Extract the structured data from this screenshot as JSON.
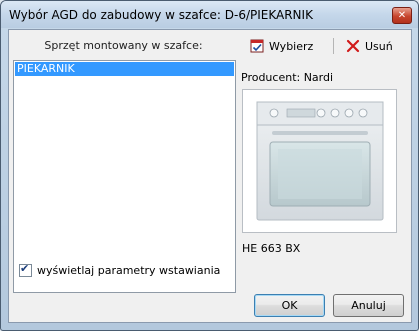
{
  "window": {
    "title": "Wybór AGD do zabudowy w szafce: D-6/PIEKARNIK"
  },
  "list": {
    "header": "Sprzęt montowany w szafce:",
    "items": [
      {
        "label": "PIEKARNIK",
        "selected": true
      }
    ]
  },
  "toolbar": {
    "choose_label": "Wybierz",
    "remove_label": "Usuń"
  },
  "details": {
    "producer": "Producent: Nardi",
    "model": "HE 663 BX"
  },
  "options": {
    "show_params_label": "wyświetlaj parametry wstawiania",
    "show_params_checked": true
  },
  "buttons": {
    "ok": "OK",
    "cancel": "Anuluj"
  },
  "colors": {
    "selection": "#3399ff",
    "remove_icon": "#d11a1a",
    "choose_icon": "#c62828"
  }
}
